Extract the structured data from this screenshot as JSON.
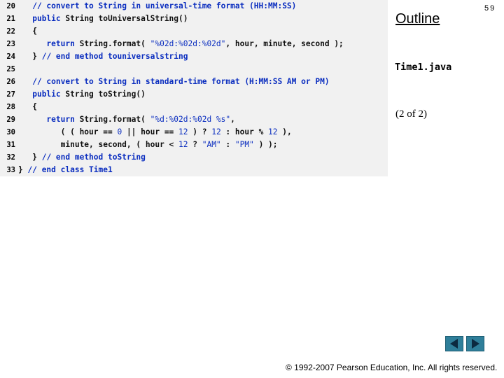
{
  "header": {
    "outline_label": "Outline",
    "page_number": "59",
    "filename": "Time1.java",
    "page_of": "(2 of 2)"
  },
  "code": {
    "lines": [
      {
        "num": "20",
        "indent": "   ",
        "parts": [
          [
            "cmt",
            "// convert to String in universal-time format (HH:MM:SS)"
          ]
        ]
      },
      {
        "num": "21",
        "indent": "   ",
        "parts": [
          [
            "kw",
            "public "
          ],
          [
            "txt",
            "String toUniversalString()"
          ]
        ]
      },
      {
        "num": "22",
        "indent": "   ",
        "parts": [
          [
            "txt",
            "{"
          ]
        ]
      },
      {
        "num": "23",
        "indent": "      ",
        "parts": [
          [
            "kw",
            "return "
          ],
          [
            "txt",
            "String.format( "
          ],
          [
            "str",
            "\"%02d:%02d:%02d\""
          ],
          [
            "txt",
            ", hour, minute, second );"
          ]
        ]
      },
      {
        "num": "24",
        "indent": "   ",
        "parts": [
          [
            "txt",
            "} "
          ],
          [
            "cmt",
            "// end method touniversalstring"
          ]
        ]
      },
      {
        "num": "25",
        "indent": "",
        "parts": []
      },
      {
        "num": "26",
        "indent": "   ",
        "parts": [
          [
            "cmt",
            "// convert to String in standard-time format (H:MM:SS AM or PM)"
          ]
        ]
      },
      {
        "num": "27",
        "indent": "   ",
        "parts": [
          [
            "kw",
            "public "
          ],
          [
            "txt",
            "String toString()"
          ]
        ]
      },
      {
        "num": "28",
        "indent": "   ",
        "parts": [
          [
            "txt",
            "{"
          ]
        ]
      },
      {
        "num": "29",
        "indent": "      ",
        "parts": [
          [
            "kw",
            "return "
          ],
          [
            "txt",
            "String.format( "
          ],
          [
            "str",
            "\"%d:%02d:%02d %s\""
          ],
          [
            "txt",
            ","
          ]
        ]
      },
      {
        "num": "30",
        "indent": "         ",
        "parts": [
          [
            "txt",
            "( ( hour == "
          ],
          [
            "num",
            "0"
          ],
          [
            "txt",
            " || hour == "
          ],
          [
            "num",
            "12"
          ],
          [
            "txt",
            " ) ? "
          ],
          [
            "num",
            "12"
          ],
          [
            "txt",
            " : hour % "
          ],
          [
            "num",
            "12"
          ],
          [
            "txt",
            " ),"
          ]
        ]
      },
      {
        "num": "31",
        "indent": "         ",
        "parts": [
          [
            "txt",
            "minute, second, ( hour < "
          ],
          [
            "num",
            "12"
          ],
          [
            "txt",
            " ? "
          ],
          [
            "str",
            "\"AM\""
          ],
          [
            "txt",
            " : "
          ],
          [
            "str",
            "\"PM\""
          ],
          [
            "txt",
            " ) );"
          ]
        ]
      },
      {
        "num": "32",
        "indent": "   ",
        "parts": [
          [
            "txt",
            "} "
          ],
          [
            "cmt",
            "// end method toString"
          ]
        ]
      },
      {
        "num": "33",
        "indent": "",
        "parts": [
          [
            "txt",
            "} "
          ],
          [
            "cmt",
            "// end class Time1"
          ]
        ]
      }
    ]
  },
  "nav": {
    "prev_icon": "triangle-left-icon",
    "next_icon": "triangle-right-icon",
    "button_color": "#2f7f9a"
  },
  "footer": {
    "copyright": "© 1992-2007 Pearson Education, Inc.  All rights reserved."
  }
}
